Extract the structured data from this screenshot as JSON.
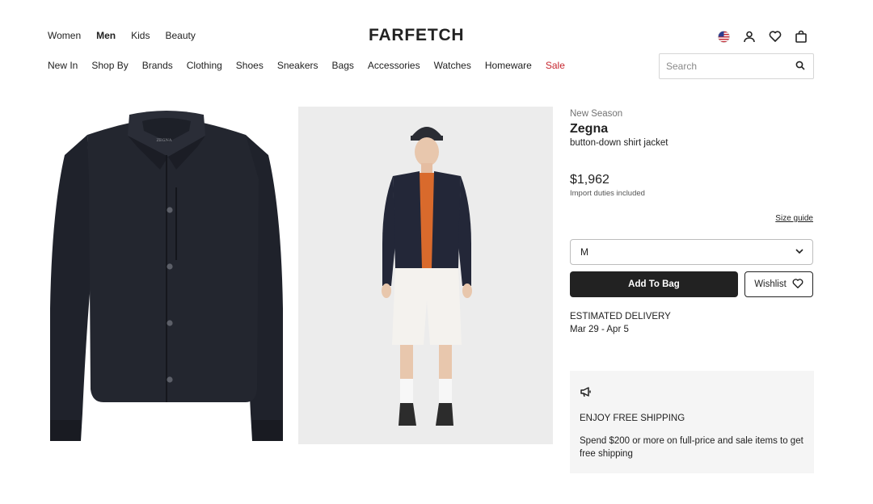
{
  "header": {
    "gender_nav": [
      {
        "label": "Women",
        "active": false
      },
      {
        "label": "Men",
        "active": true
      },
      {
        "label": "Kids",
        "active": false
      },
      {
        "label": "Beauty",
        "active": false
      }
    ],
    "logo": "FARFETCH",
    "icons": [
      "us-flag-icon",
      "account-icon",
      "heart-icon",
      "bag-icon"
    ]
  },
  "category_nav": [
    "New In",
    "Shop By",
    "Brands",
    "Clothing",
    "Shoes",
    "Sneakers",
    "Bags",
    "Accessories",
    "Watches",
    "Homeware",
    "Sale"
  ],
  "search": {
    "placeholder": "Search",
    "value": ""
  },
  "product": {
    "season": "New Season",
    "brand": "Zegna",
    "description": "button-down shirt jacket",
    "price": "$1,962",
    "duties": "Import duties included",
    "size_guide": "Size guide",
    "selected_size": "M",
    "add_to_bag": "Add To Bag",
    "wishlist": "Wishlist",
    "delivery_title": "ESTIMATED DELIVERY",
    "delivery_date": "Mar 29 - Apr 5",
    "jacket_label": "ZEGNA"
  },
  "shipping": {
    "title": "ENJOY FREE SHIPPING",
    "body": "Spend $200 or more on full-price and sale items to get free shipping"
  },
  "colors": {
    "accent": "#222222",
    "sale": "#c6262e",
    "jacket": "#23262f",
    "promo_bg": "#f5f5f5"
  }
}
